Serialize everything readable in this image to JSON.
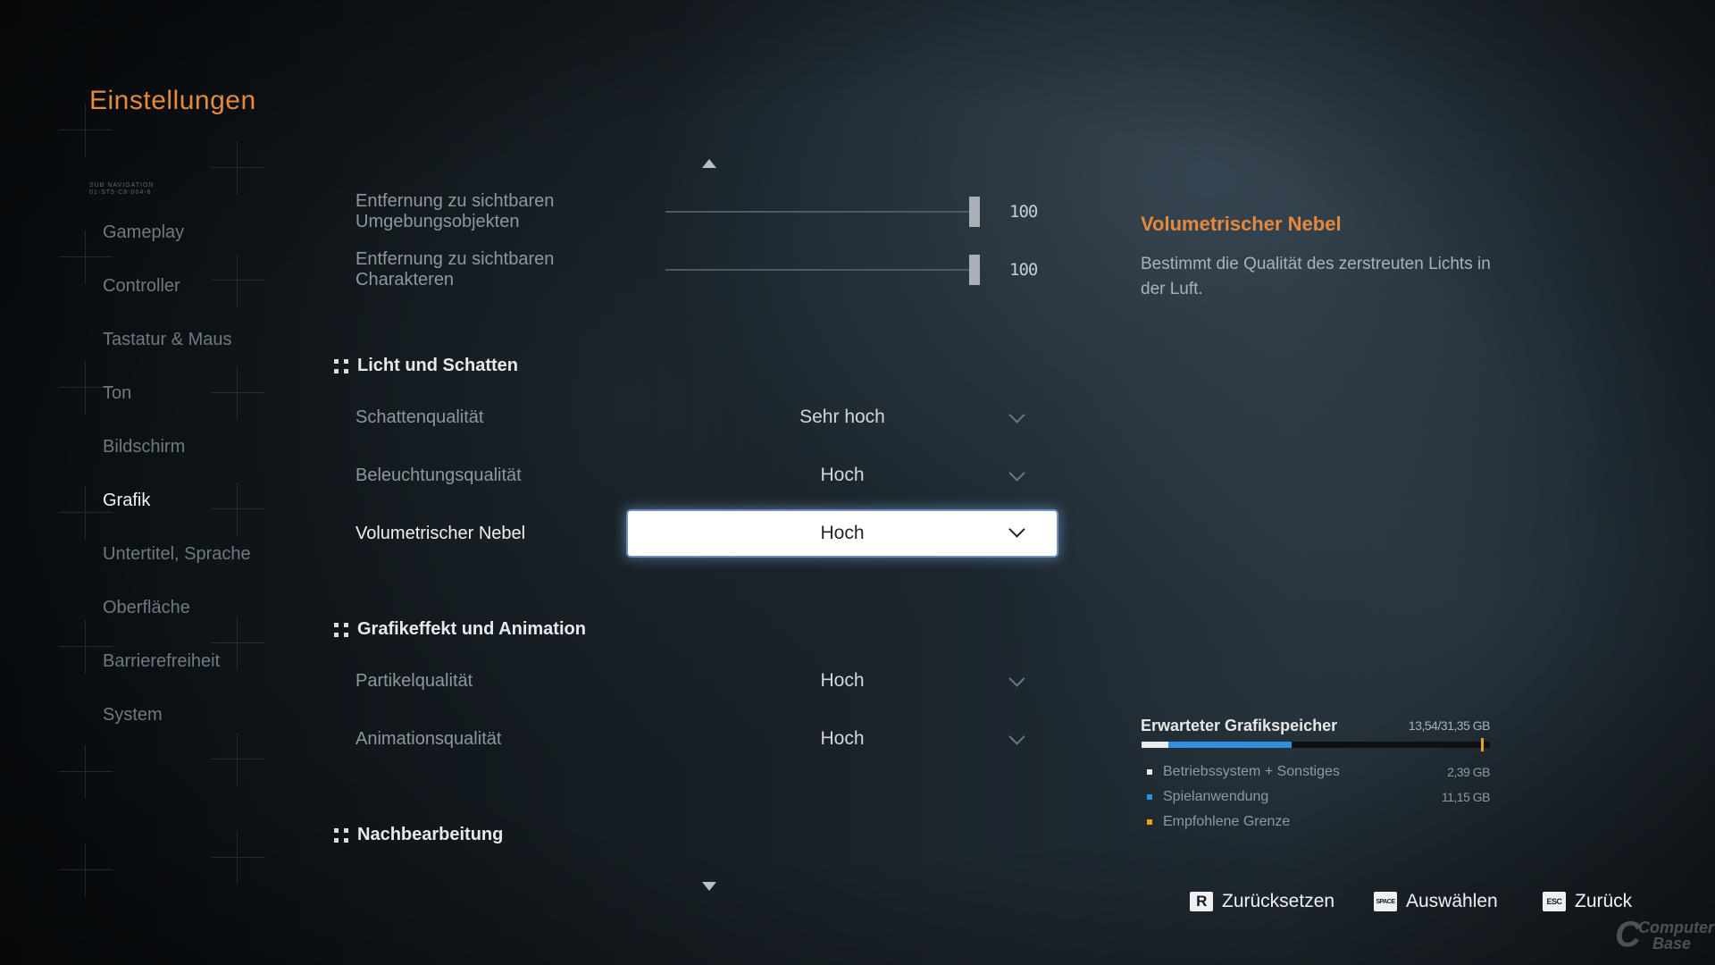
{
  "page": {
    "title": "Einstellungen",
    "caption_line1": "SUB NAVIGATION",
    "caption_line2": "01-ST5-C8-004-6"
  },
  "nav": {
    "items": [
      {
        "label": "Gameplay"
      },
      {
        "label": "Controller"
      },
      {
        "label": "Tastatur & Maus"
      },
      {
        "label": "Ton"
      },
      {
        "label": "Bildschirm"
      },
      {
        "label": "Grafik",
        "active": true
      },
      {
        "label": "Untertitel, Sprache"
      },
      {
        "label": "Oberfläche"
      },
      {
        "label": "Barrierefreiheit"
      },
      {
        "label": "System"
      }
    ]
  },
  "settings": {
    "sliders": [
      {
        "label_line1": "Entfernung zu sichtbaren",
        "label_line2": "Umgebungsobjekten",
        "value": "100",
        "fraction": 1.0
      },
      {
        "label_line1": "Entfernung zu sichtbaren",
        "label_line2": "Charakteren",
        "value": "100",
        "fraction": 1.0
      }
    ],
    "sections": [
      {
        "title": "Licht und Schatten"
      },
      {
        "title": "Grafikeffekt und Animation"
      },
      {
        "title": "Nachbearbeitung"
      }
    ],
    "selects": [
      {
        "label": "Schattenqualität",
        "value": "Sehr hoch"
      },
      {
        "label": "Beleuchtungsqualität",
        "value": "Hoch"
      },
      {
        "label": "Volumetrischer Nebel",
        "value": "Hoch",
        "focused": true
      },
      {
        "label": "Partikelqualität",
        "value": "Hoch"
      },
      {
        "label": "Animationsqualität",
        "value": "Hoch"
      }
    ]
  },
  "description": {
    "title": "Volumetrischer Nebel",
    "text": "Bestimmt die Qualität des zerstreuten Lichts in der Luft."
  },
  "memory": {
    "title": "Erwarteter Grafikspeicher",
    "total": "13,54/31,35 GB",
    "used_fraction_os": 0.0762,
    "used_fraction_app": 0.3556,
    "limit_fraction": 0.975,
    "colors": {
      "os": "#e8ecee",
      "app": "#2f8fe0",
      "limit": "#f0a020"
    },
    "legend": [
      {
        "label": "Betriebssystem + Sonstiges",
        "value": "2,39 GB",
        "color": "#e8ecee"
      },
      {
        "label": "Spielanwendung",
        "value": "11,15 GB",
        "color": "#2f8fe0"
      },
      {
        "label": "Empfohlene Grenze",
        "value": "",
        "color": "#f0a020"
      }
    ]
  },
  "footer": {
    "reset": {
      "key": "R",
      "label": "Zurücksetzen"
    },
    "select": {
      "key": "SPACE",
      "label": "Auswählen"
    },
    "back": {
      "key": "ESC",
      "label": "Zurück"
    }
  },
  "watermark": {
    "line1": "Computer",
    "line2": "Base",
    "letter": "C"
  }
}
